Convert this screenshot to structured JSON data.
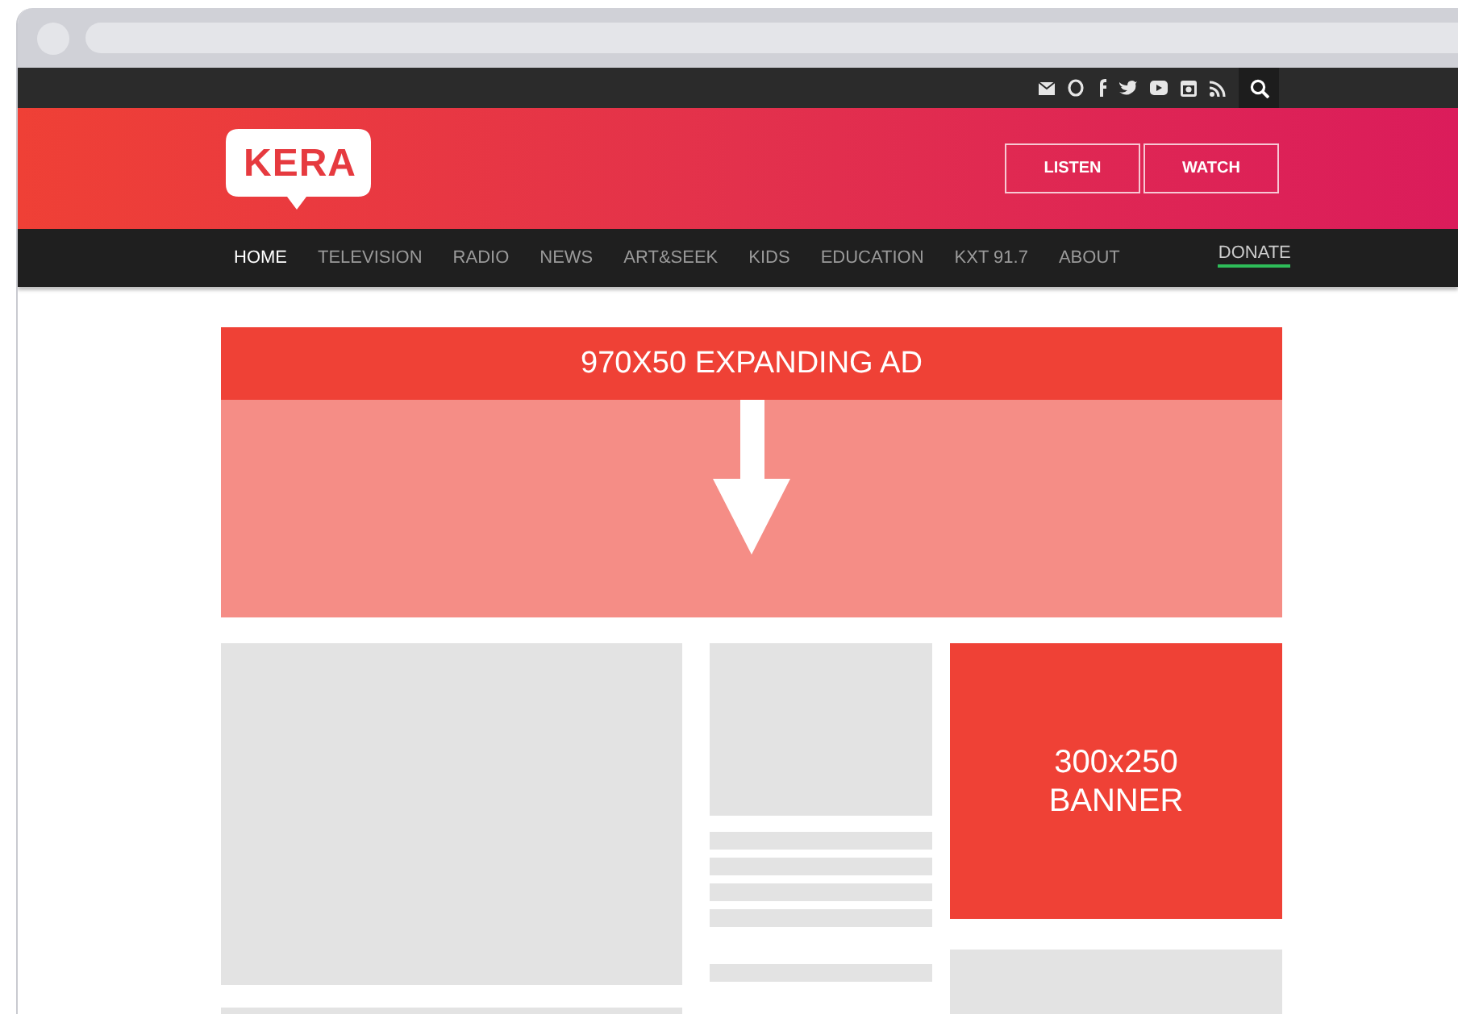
{
  "header": {
    "logo": "KERA",
    "buttons": [
      "LISTEN",
      "WATCH"
    ]
  },
  "nav": [
    {
      "label": "HOME",
      "selected": true,
      "kind": "link"
    },
    {
      "label": "TELEVISION",
      "selected": false,
      "kind": "link"
    },
    {
      "label": "RADIO",
      "selected": false,
      "kind": "link"
    },
    {
      "label": "NEWS",
      "selected": false,
      "kind": "link"
    },
    {
      "label": "ART&SEEK",
      "selected": false,
      "kind": "link"
    },
    {
      "label": "KIDS",
      "selected": false,
      "kind": "link"
    },
    {
      "label": "EDUCATION",
      "selected": false,
      "kind": "link"
    },
    {
      "label": "KXT 91.7",
      "selected": false,
      "kind": "link"
    },
    {
      "label": "ABOUT",
      "selected": false,
      "kind": "link"
    },
    {
      "label": "DONATE",
      "selected": false,
      "kind": "donate"
    }
  ],
  "expanding_ad": {
    "label": "970X50 EXPANDING AD"
  },
  "banner_ad": {
    "label": "300x250 BANNER"
  }
}
